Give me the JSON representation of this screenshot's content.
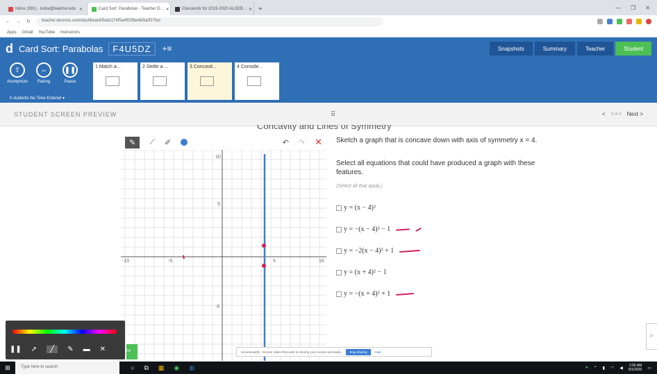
{
  "browser": {
    "tabs": [
      {
        "title": "Inbox (391) - lcoke@teacher.edu",
        "active": false
      },
      {
        "title": "Card Sort: Parabolas - Teacher D...",
        "active": true
      },
      {
        "title": "Classwork for 2019-2020 ALGEB...",
        "active": false
      }
    ],
    "new_tab": "+",
    "url": "teacher.desmos.com/dashboard/5ab1174f5a4f02fbe4b0a0f1?toc",
    "bookmarks": [
      "Apps",
      "Gmail",
      "YouTube",
      "Instructors"
    ]
  },
  "app": {
    "logo": "d",
    "title": "Card Sort: Parabolas",
    "class_code": "F4U5DZ",
    "invite_icon": "+≡",
    "right_tabs": [
      {
        "label": "Snapshots",
        "active": false
      },
      {
        "label": "Summary",
        "active": false
      },
      {
        "label": "Teacher",
        "active": false
      },
      {
        "label": "Student",
        "active": true
      }
    ]
  },
  "toolbar": {
    "tools": [
      {
        "label": "Anonymize",
        "icon": "anonymize-icon",
        "glyph": "⇧"
      },
      {
        "label": "Pacing",
        "icon": "pacing-icon",
        "glyph": "⇔"
      },
      {
        "label": "Pause",
        "icon": "pause-icon",
        "glyph": "❚❚"
      }
    ],
    "pace_info": "0 students  No Time Entered ▾",
    "cards": [
      {
        "label": "1 Match a...",
        "selected": false
      },
      {
        "label": "2 Settle a ...",
        "selected": false
      },
      {
        "label": "3 Concavit...",
        "selected": true
      },
      {
        "label": "4 Conside...",
        "selected": false
      }
    ]
  },
  "preview": {
    "label": "STUDENT SCREEN PREVIEW",
    "drag_icon": "⠿",
    "prev": "<",
    "page_label": "3 of 4",
    "next": "Next >"
  },
  "page": {
    "title": "Concavity and Lines of Symmetry"
  },
  "graph": {
    "tools": [
      "✎",
      "⟋",
      "✐"
    ],
    "undo": "↶",
    "redo": "↷",
    "clear": "✕",
    "x_ticks": [
      "-10",
      "-5",
      "5",
      "10"
    ],
    "y_ticks": [
      "10",
      "5",
      "-5"
    ],
    "color": "#3c7dd6"
  },
  "question": {
    "prompt": "Sketch a graph that is concave down with axis of symmetry x = 4.",
    "instruction": "Select all equations that could have produced a graph with these features.",
    "hint": "(Select all that apply.)",
    "options": [
      {
        "text": "y = (x − 4)²",
        "marked": false
      },
      {
        "text": "y = −(x − 4)² − 1",
        "marked": true
      },
      {
        "text": "y = −2(x − 4)² + 1",
        "marked": true
      },
      {
        "text": "y = (x + 4)² − 1",
        "marked": false
      },
      {
        "text": "y = −(x + 4)² + 1",
        "marked": true
      }
    ]
  },
  "annotation_bar": {
    "icons": [
      "❚❚",
      "➚",
      "╱",
      "✎",
      "▬",
      "✕"
    ]
  },
  "green_button": "ns",
  "share_bar": {
    "message": "Screencastify - Screen Video Recorder is sharing your screen and audio.",
    "stop": "Stop sharing",
    "hide": "Hide"
  },
  "edge_button": ">",
  "taskbar": {
    "start": "⊞",
    "search_placeholder": "Type here to search",
    "apps": [
      "○",
      "⧉",
      "▦",
      "◉",
      "◍"
    ],
    "time": "2:55 AM",
    "date": "5/1/2020"
  }
}
